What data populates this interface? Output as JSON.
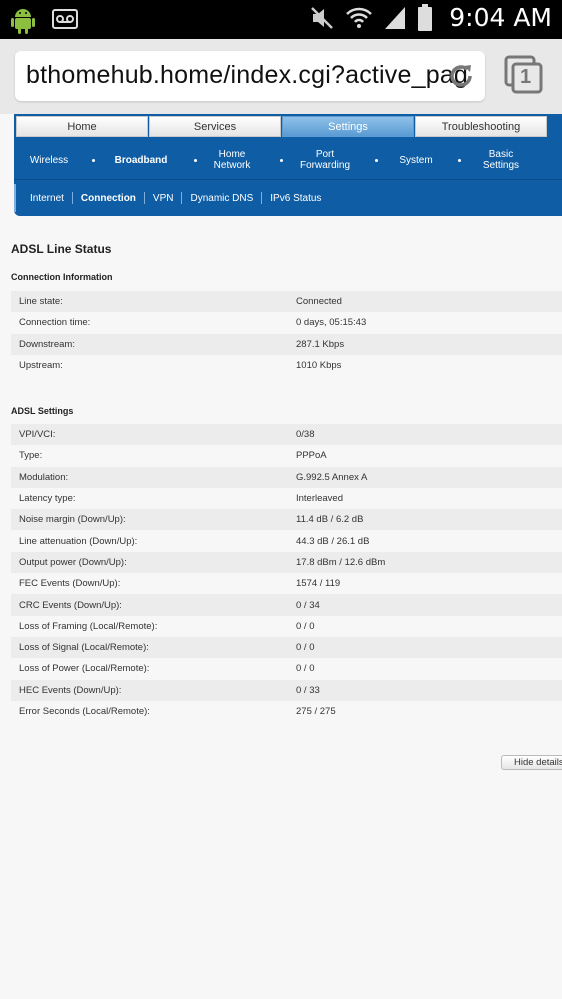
{
  "status_bar": {
    "time": "9:04 AM",
    "icons": [
      "android-icon",
      "voicemail-icon",
      "mute-icon",
      "wifi-icon",
      "signal-icon",
      "battery-icon"
    ]
  },
  "browser": {
    "url": "bthomehub.home/index.cgi?active_pag",
    "tab_count": "1"
  },
  "nav": {
    "top_tabs": [
      {
        "label": "Home"
      },
      {
        "label": "Services"
      },
      {
        "label": "Settings"
      },
      {
        "label": "Troubleshooting"
      }
    ],
    "sub_items": [
      {
        "label": "Wireless"
      },
      {
        "label": "Broadband"
      },
      {
        "label": "Home Network"
      },
      {
        "label": "Port Forwarding"
      },
      {
        "label": "System"
      },
      {
        "label": "Basic Settings"
      }
    ],
    "third_items": [
      {
        "label": "Internet"
      },
      {
        "label": "Connection"
      },
      {
        "label": "VPN"
      },
      {
        "label": "Dynamic DNS"
      },
      {
        "label": "IPv6 Status"
      }
    ]
  },
  "page": {
    "title": "ADSL Line Status",
    "connection_heading": "Connection Information",
    "connection_rows": [
      {
        "label": "Line state:",
        "value": "Connected"
      },
      {
        "label": "Connection time:",
        "value": "0 days, 05:15:43"
      },
      {
        "label": "Downstream:",
        "value": "287.1 Kbps"
      },
      {
        "label": "Upstream:",
        "value": "1010 Kbps"
      }
    ],
    "adsl_heading": "ADSL Settings",
    "adsl_rows": [
      {
        "label": "VPI/VCI:",
        "value": "0/38"
      },
      {
        "label": "Type:",
        "value": "PPPoA"
      },
      {
        "label": "Modulation:",
        "value": "G.992.5 Annex A"
      },
      {
        "label": "Latency type:",
        "value": "Interleaved"
      },
      {
        "label": "Noise margin (Down/Up):",
        "value": "11.4 dB / 6.2 dB"
      },
      {
        "label": "Line attenuation (Down/Up):",
        "value": "44.3 dB / 26.1 dB"
      },
      {
        "label": "Output power (Down/Up):",
        "value": "17.8 dBm / 12.6 dBm"
      },
      {
        "label": "FEC Events (Down/Up):",
        "value": "1574 / 119"
      },
      {
        "label": "CRC Events (Down/Up):",
        "value": "0 / 34"
      },
      {
        "label": "Loss of Framing (Local/Remote):",
        "value": "0 / 0"
      },
      {
        "label": "Loss of Signal (Local/Remote):",
        "value": "0 / 0"
      },
      {
        "label": "Loss of Power (Local/Remote):",
        "value": "0 / 0"
      },
      {
        "label": "HEC Events (Down/Up):",
        "value": "0 / 33"
      },
      {
        "label": "Error Seconds (Local/Remote):",
        "value": "275 / 275"
      }
    ],
    "hide_details_label": "Hide details"
  }
}
